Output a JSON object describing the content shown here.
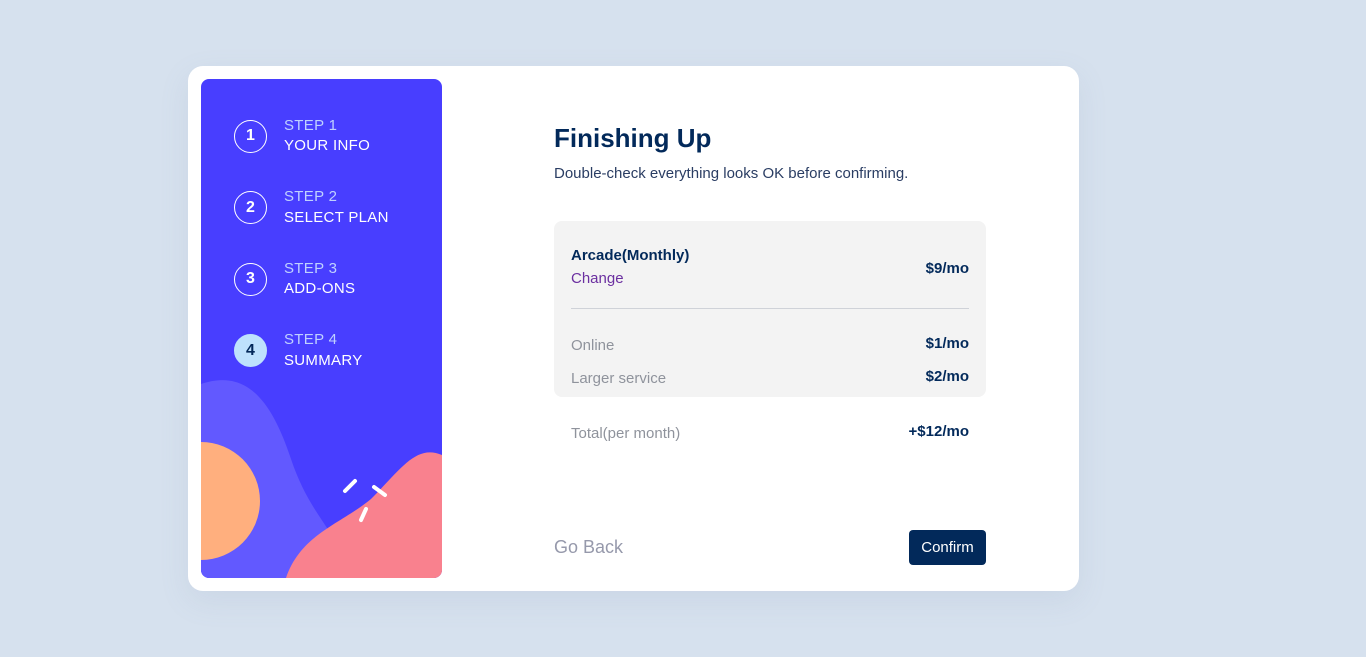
{
  "colors": {
    "page_background": "#d6e1ee",
    "sidebar_background": "#483eff",
    "active_step": "#bee2fd",
    "primary_dark": "#02295a",
    "change_link": "#6b2fa0",
    "muted_text": "#8f939c",
    "blob_orange": "#ffaf7e",
    "blob_pink": "#f9818e",
    "blob_purple": "#6259ff"
  },
  "sidebar": {
    "steps": [
      {
        "number": "1",
        "label": "STEP 1",
        "title": "YOUR INFO",
        "active": false
      },
      {
        "number": "2",
        "label": "STEP 2",
        "title": "SELECT PLAN",
        "active": false
      },
      {
        "number": "3",
        "label": "STEP 3",
        "title": "ADD-ONS",
        "active": false
      },
      {
        "number": "4",
        "label": "STEP 4",
        "title": "SUMMARY",
        "active": true
      }
    ]
  },
  "main": {
    "title": "Finishing Up",
    "subtitle": "Double-check everything looks OK before confirming."
  },
  "summary": {
    "plan_name": "Arcade(Monthly)",
    "change_label": "Change",
    "plan_price": "$9/mo",
    "addons": [
      {
        "name": "Online",
        "price": "$1/mo"
      },
      {
        "name": "Larger service",
        "price": "$2/mo"
      }
    ]
  },
  "total": {
    "label": "Total(per month)",
    "value": "+$12/mo"
  },
  "actions": {
    "go_back_label": "Go Back",
    "confirm_label": "Confirm"
  }
}
